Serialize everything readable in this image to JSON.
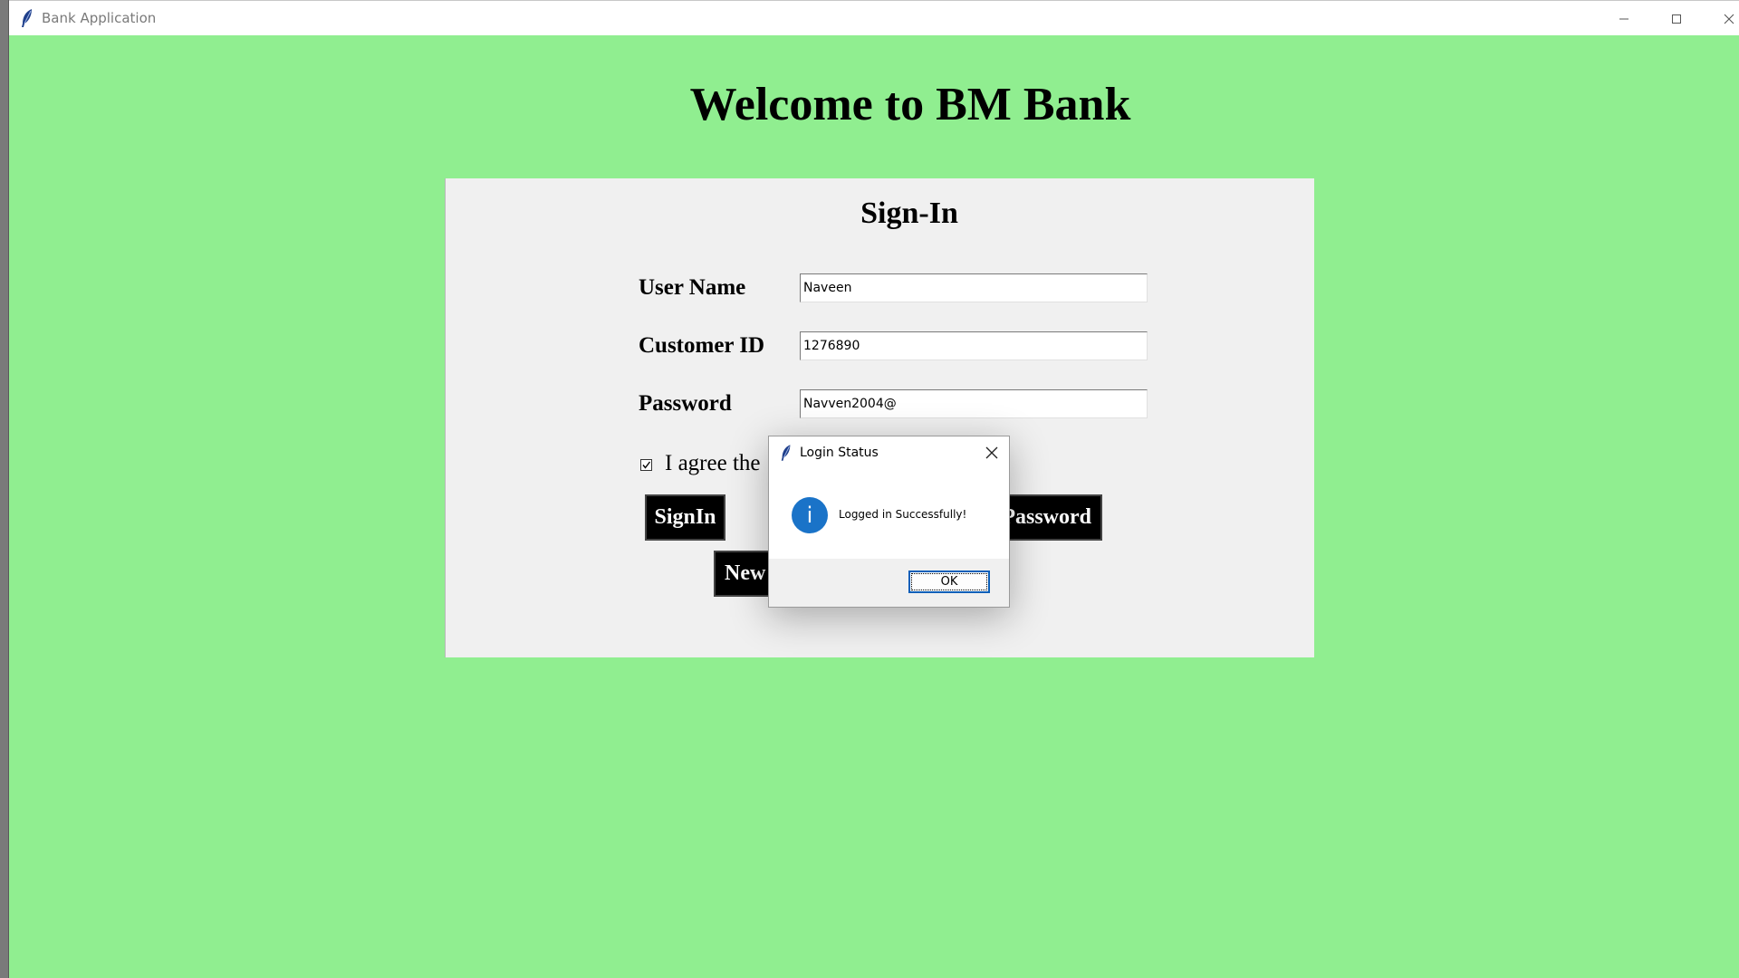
{
  "window": {
    "title": "Bank Application",
    "background": "#90ee90",
    "icons": [
      "feather-icon",
      "minimize-icon",
      "maximize-icon",
      "close-icon"
    ]
  },
  "main": {
    "welcome": "Welcome to BM Bank"
  },
  "signin": {
    "title": "Sign-In",
    "username_label": "User Name",
    "username_value": "Naveen",
    "customer_id_label": "Customer ID",
    "customer_id_value": "1276890",
    "password_label": "Password",
    "password_value": "Navven2004@",
    "agree_label": "I agree the",
    "agree_checked": true,
    "signin_button": "SignIn",
    "forgot_button_visible": "Password",
    "new_button_visible": "New"
  },
  "dialog": {
    "title": "Login Status",
    "message": "Logged in Successfully!",
    "ok_label": "OK",
    "icons": [
      "feather-icon",
      "info-icon",
      "close-icon"
    ],
    "accent": "#1a73c8"
  }
}
